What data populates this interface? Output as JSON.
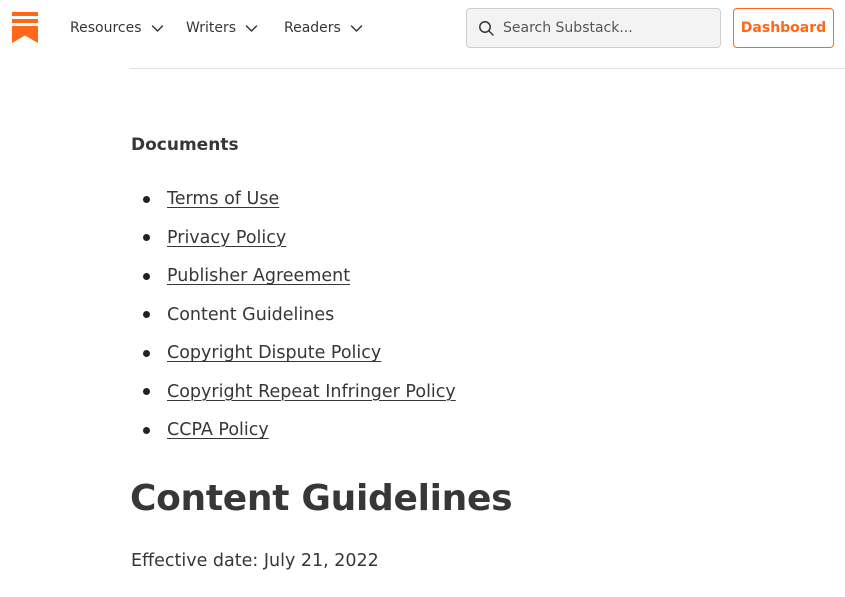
{
  "header": {
    "logo_icon": "substack-bookmark-icon",
    "brand_color": "#ff6719",
    "nav": [
      {
        "label": "Resources",
        "icon": "chevron-down-icon"
      },
      {
        "label": "Writers",
        "icon": "chevron-down-icon"
      },
      {
        "label": "Readers",
        "icon": "chevron-down-icon"
      }
    ],
    "search": {
      "placeholder": "Search Substack...",
      "value": "",
      "icon": "search-icon"
    },
    "dashboard_label": "Dashboard"
  },
  "documents": {
    "heading": "Documents",
    "items": [
      {
        "label": "Terms of Use",
        "link": true
      },
      {
        "label": "Privacy Policy",
        "link": true
      },
      {
        "label": "Publisher Agreement",
        "link": true
      },
      {
        "label": "Content Guidelines",
        "link": false
      },
      {
        "label": "Copyright Dispute Policy",
        "link": true
      },
      {
        "label": "Copyright Repeat Infringer Policy",
        "link": true
      },
      {
        "label": "CCPA Policy",
        "link": true
      }
    ]
  },
  "page": {
    "title": "Content Guidelines",
    "effective_date": "Effective date: July 21, 2022"
  }
}
